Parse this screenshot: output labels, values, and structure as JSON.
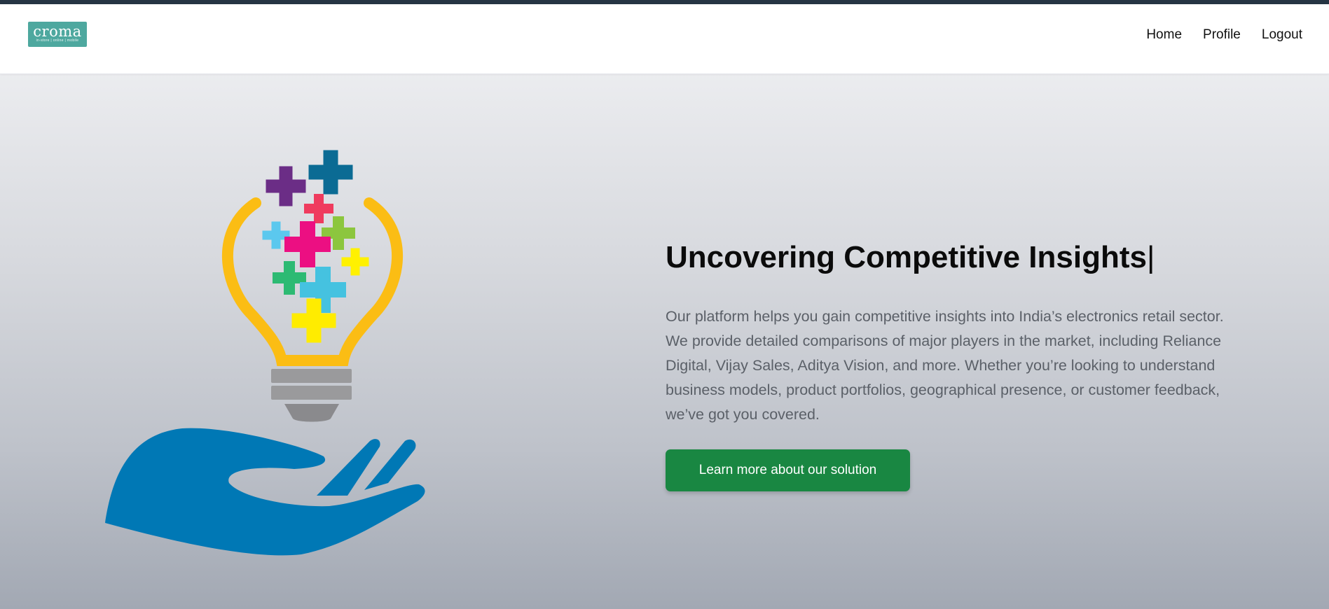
{
  "brand": {
    "logo_word": "croma",
    "logo_tagline": "in-store | online | mobile"
  },
  "nav": {
    "links": [
      {
        "label": "Home"
      },
      {
        "label": "Profile"
      },
      {
        "label": "Logout"
      }
    ]
  },
  "hero": {
    "headline": "Uncovering Competitive Insights",
    "caret": "|",
    "description": "Our platform helps you gain competitive insights into India’s electronics retail sector. We provide detailed comparisons of major players in the market, including Reliance Digital, Vijay Sales, Aditya Vision, and more. Whether you’re looking to understand business models, product portfolios, geographical presence, or customer feedback, we’ve got you covered.",
    "cta_label": "Learn more about our solution",
    "illustration_icon": "lightbulb-hand-icon"
  },
  "colors": {
    "brand_teal": "#4ea89f",
    "cta_green": "#198742",
    "bulb_yellow": "#fbbd14",
    "hand_blue": "#0078b5"
  }
}
